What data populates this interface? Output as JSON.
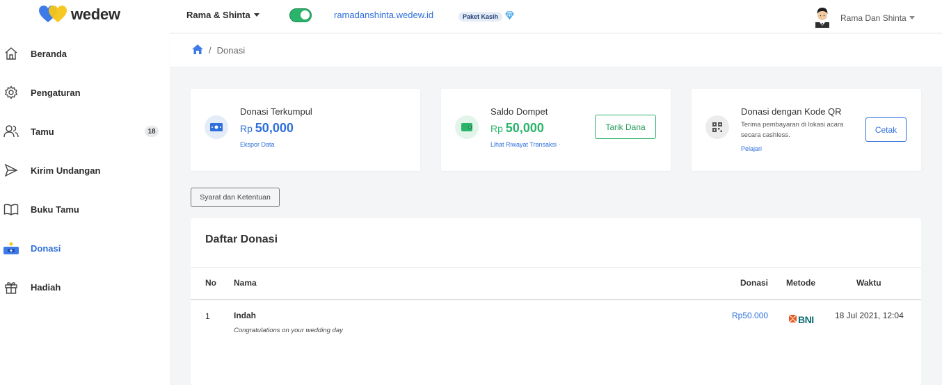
{
  "brand": {
    "name": "wedew"
  },
  "sidebar": {
    "items": [
      {
        "label": "Beranda",
        "icon": "home-icon"
      },
      {
        "label": "Pengaturan",
        "icon": "gear-icon"
      },
      {
        "label": "Tamu",
        "icon": "users-icon",
        "badge": "18"
      },
      {
        "label": "Kirim Undangan",
        "icon": "send-icon"
      },
      {
        "label": "Buku Tamu",
        "icon": "book-icon"
      },
      {
        "label": "Donasi",
        "icon": "donation-icon",
        "active": true
      },
      {
        "label": "Hadiah",
        "icon": "gift-icon"
      }
    ]
  },
  "topbar": {
    "couple": "Rama & Shinta",
    "site_url": "ramadanshinta.wedew.id",
    "package": "Paket Kasih",
    "user_name": "Rama Dan Shinta",
    "toggle_on": true
  },
  "breadcrumb": {
    "current": "Donasi"
  },
  "cards": {
    "donation": {
      "title": "Donasi Terkumpul",
      "currency": "Rp",
      "amount": "50,000",
      "link": "Ekspor Data"
    },
    "wallet": {
      "title": "Saldo Dompet",
      "currency": "Rp",
      "amount": "50,000",
      "link": "Lihat Riwayat Transaksi ·",
      "button": "Tarik Dana"
    },
    "qr": {
      "title": "Donasi dengan Kode QR",
      "description": "Terima pembayaran di lokasi acara secara cashless.",
      "link": "Pelajari",
      "button": "Cetak"
    }
  },
  "terms_button": "Syarat dan Ketentuan",
  "table": {
    "title": "Daftar Donasi",
    "headers": {
      "no": "No",
      "name": "Nama",
      "amount": "Donasi",
      "method": "Metode",
      "time": "Waktu"
    },
    "rows": [
      {
        "no": "1",
        "name": "Indah",
        "message": "Congratulations on your wedding day",
        "amount": "Rp50.000",
        "method": "BNI",
        "time": "18 Jul 2021, 12:04"
      }
    ]
  },
  "colors": {
    "accent": "#2f6fdb",
    "success": "#2ab36a",
    "bni": "#e55a1f"
  }
}
